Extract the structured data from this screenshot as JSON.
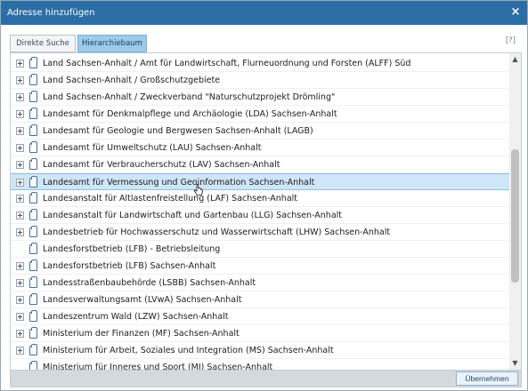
{
  "dialog": {
    "title": "Adresse hinzufügen",
    "close_label": "×",
    "help_label": "[?]",
    "submit_label": "Übernehmen"
  },
  "tabs": [
    {
      "label": "Direkte Suche",
      "active": false
    },
    {
      "label": "Hierarchiebaum",
      "active": true
    }
  ],
  "tree": {
    "selected_index": 7,
    "items": [
      {
        "label": "Land Sachsen-Anhalt / Amt für Landwirtschaft, Flurneuordnung und Forsten (ALFF) Süd",
        "expandable": true
      },
      {
        "label": "Land Sachsen-Anhalt / Großschutzgebiete",
        "expandable": true
      },
      {
        "label": "Land Sachsen-Anhalt / Zweckverband \"Naturschutzprojekt Drömling\"",
        "expandable": true
      },
      {
        "label": "Landesamt für Denkmalpflege und Archäologie (LDA) Sachsen-Anhalt",
        "expandable": true
      },
      {
        "label": "Landesamt für Geologie und Bergwesen Sachsen-Anhalt (LAGB)",
        "expandable": true
      },
      {
        "label": "Landesamt für Umweltschutz (LAU) Sachsen-Anhalt",
        "expandable": true
      },
      {
        "label": "Landesamt für Verbraucherschutz (LAV) Sachsen-Anhalt",
        "expandable": true
      },
      {
        "label": "Landesamt für Vermessung und Geoinformation Sachsen-Anhalt",
        "expandable": true
      },
      {
        "label": "Landesanstalt für Altlastenfreistellung (LAF) Sachsen-Anhalt",
        "expandable": true
      },
      {
        "label": "Landesanstalt für Landwirtschaft und Gartenbau (LLG) Sachsen-Anhalt",
        "expandable": true
      },
      {
        "label": "Landesbetrieb für Hochwasserschutz und Wasserwirtschaft (LHW) Sachsen-Anhalt",
        "expandable": true
      },
      {
        "label": "Landesforstbetrieb (LFB) - Betriebsleitung",
        "expandable": false
      },
      {
        "label": "Landesforstbetrieb (LFB) Sachsen-Anhalt",
        "expandable": true
      },
      {
        "label": "Landesstraßenbaubehörde (LSBB) Sachsen-Anhalt",
        "expandable": true
      },
      {
        "label": "Landesverwaltungsamt (LVwA) Sachsen-Anhalt",
        "expandable": true
      },
      {
        "label": "Landeszentrum Wald (LZW) Sachsen-Anhalt",
        "expandable": true
      },
      {
        "label": "Ministerium der Finanzen (MF) Sachsen-Anhalt",
        "expandable": true
      },
      {
        "label": "Ministerium für Arbeit, Soziales und Integration (MS) Sachsen-Anhalt",
        "expandable": true
      },
      {
        "label": "Ministerium für Inneres und Sport (MI) Sachsen-Anhalt",
        "expandable": false
      }
    ]
  },
  "icons": {
    "expand": "plus-box-icon",
    "node": "folder-icon",
    "close": "close-icon",
    "cursor": "pointer-cursor-icon"
  },
  "colors": {
    "titlebar": "#2b6ea6",
    "selected_row": "#cfe6f8",
    "active_tab": "#9ccaea"
  }
}
